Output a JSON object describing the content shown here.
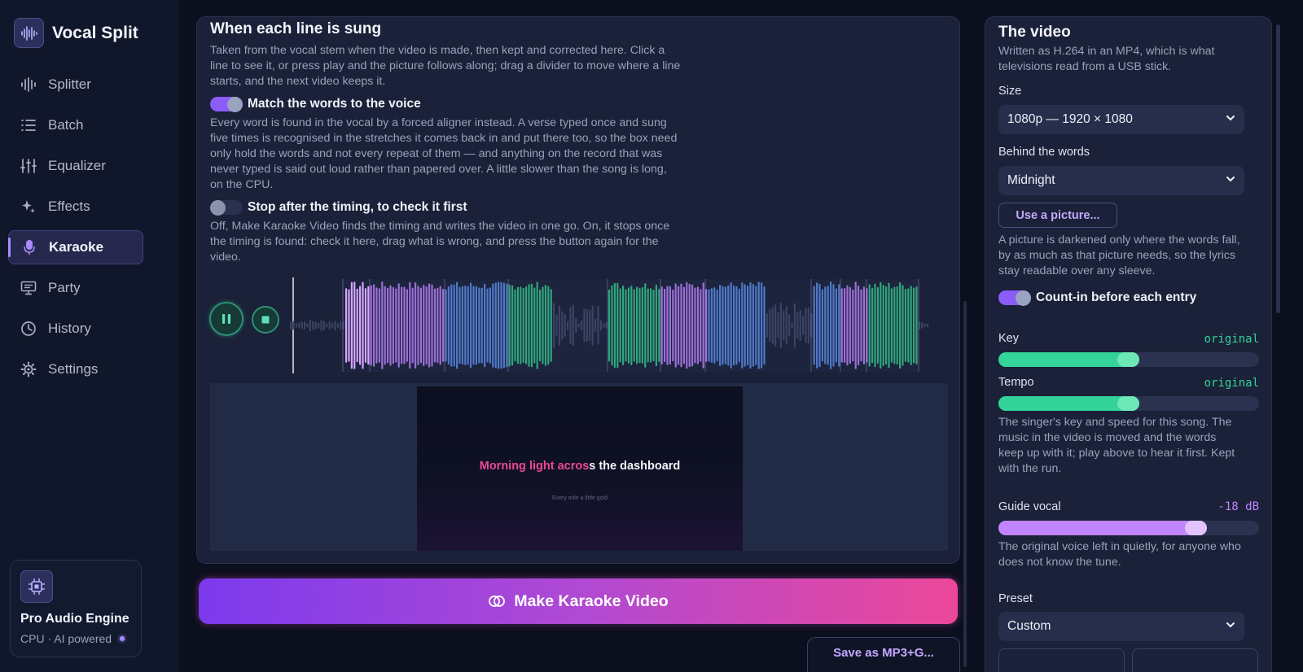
{
  "app": {
    "name": "Vocal Split"
  },
  "sidebar": {
    "items": [
      {
        "label": "Splitter",
        "icon": "waveform-icon"
      },
      {
        "label": "Batch",
        "icon": "list-icon"
      },
      {
        "label": "Equalizer",
        "icon": "sliders-icon"
      },
      {
        "label": "Effects",
        "icon": "sparkle-icon"
      },
      {
        "label": "Karaoke",
        "icon": "microphone-icon",
        "active": true
      },
      {
        "label": "Party",
        "icon": "monitor-icon"
      },
      {
        "label": "History",
        "icon": "clock-icon"
      },
      {
        "label": "Settings",
        "icon": "gear-icon"
      }
    ],
    "engine": {
      "title": "Pro Audio Engine",
      "subtitle": "CPU · AI powered"
    }
  },
  "timing": {
    "title": "When each line is sung",
    "description": "Taken from the vocal stem when the video is made, then kept and corrected here. Click a line to see it, or press play and the picture follows along; drag a divider to move where a line starts, and the next video keeps it.",
    "match_toggle": {
      "label": "Match the words to the voice",
      "on": true,
      "description": "Every word is found in the vocal by a forced aligner instead. A verse typed once and sung five times is recognised in the stretches it comes back in and put there too, so the box need only hold the words and not every repeat of them — and anything on the record that was never typed is said out loud rather than papered over. A little slower than the song is long, on the CPU."
    },
    "stop_toggle": {
      "label": "Stop after the timing, to check it first",
      "on": false,
      "description": "Off, Make Karaoke Video finds the timing and writes the video in one go. On, it stops once the timing is found: check it here, drag what is wrong, and press the button again for the video."
    },
    "player": {
      "playing": true
    }
  },
  "preview": {
    "lyric_sung": "Morning light acros",
    "lyric_rest": "s the dashboard",
    "next_line": "Every mile a little gold"
  },
  "actions": {
    "make_label": "Make Karaoke Video",
    "save_label": "Save as MP3+G..."
  },
  "video": {
    "title": "The video",
    "description": "Written as H.264 in an MP4, which is what televisions read from a USB stick.",
    "size_label": "Size",
    "size_value": "1080p — 1920 × 1080",
    "behind_label": "Behind the words",
    "behind_value": "Midnight",
    "picture_button": "Use a picture...",
    "picture_note": "A picture is darkened only where the words fall, by as much as that picture needs, so the lyrics stay readable over any sleeve.",
    "countin": {
      "label": "Count-in before each entry",
      "on": true
    },
    "key": {
      "label": "Key",
      "value": "original",
      "level": 0.54
    },
    "tempo": {
      "label": "Tempo",
      "value": "original",
      "level": 0.54
    },
    "key_tempo_note": "The singer's key and speed for this song. The music in the video is moved and the words keep up with it; play above to hear it first. Kept with the run.",
    "guide": {
      "label": "Guide vocal",
      "value": "-18 dB",
      "level": 0.8
    },
    "guide_note": "The original voice left in quietly, for anyone who does not know the tune.",
    "preset_label": "Preset",
    "preset_value": "Custom"
  },
  "colors": {
    "accent": "#8b5cf6",
    "pink": "#ec4899",
    "green": "#34d399",
    "lavender": "#c4a9ff"
  }
}
